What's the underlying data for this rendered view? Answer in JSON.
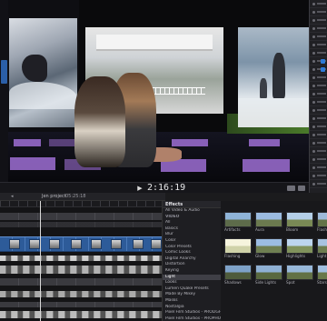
{
  "viewer": {
    "timecode": "2:16:19",
    "play_icon": "play-icon"
  },
  "timeline": {
    "project_name": "Jen project",
    "duration": "05:25:18"
  },
  "effects": {
    "title": "Effects",
    "categories": [
      {
        "label": "All Video & Audio",
        "kind": "item"
      },
      {
        "label": "VIDEO",
        "kind": "header"
      },
      {
        "label": "All",
        "kind": "item"
      },
      {
        "label": "Basics",
        "kind": "item"
      },
      {
        "label": "Blur",
        "kind": "item"
      },
      {
        "label": "Color",
        "kind": "item"
      },
      {
        "label": "Color Presets",
        "kind": "item"
      },
      {
        "label": "Comic Looks",
        "kind": "item"
      },
      {
        "label": "Digital Anarchy",
        "kind": "item"
      },
      {
        "label": "Distortion",
        "kind": "item"
      },
      {
        "label": "Keying",
        "kind": "item"
      },
      {
        "label": "Light",
        "kind": "selected"
      },
      {
        "label": "Looks",
        "kind": "item"
      },
      {
        "label": "Lumen Quake Presets",
        "kind": "item"
      },
      {
        "label": "Made By Mikey",
        "kind": "item"
      },
      {
        "label": "Masks",
        "kind": "item"
      },
      {
        "label": "Nostalgia",
        "kind": "item"
      },
      {
        "label": "Pixel Film Studios - PROLIGHTNI...",
        "kind": "item"
      },
      {
        "label": "Pixel Film Studios - PROPHOS 3X",
        "kind": "item"
      }
    ],
    "tiles": [
      {
        "label": "Artifacts",
        "top": "#8fb4d8",
        "bottom": "#5d6b4a"
      },
      {
        "label": "Aura",
        "top": "#9bbbe0",
        "bottom": "#6b7a4f"
      },
      {
        "label": "Bloom",
        "top": "#b4cfe8",
        "bottom": "#798955"
      },
      {
        "label": "Flash B",
        "top": "#9db9d9",
        "bottom": "#647347"
      },
      {
        "label": "Flashing",
        "top": "#f6f4dd",
        "bottom": "#cfd2a8"
      },
      {
        "label": "Glow",
        "top": "#9cbde3",
        "bottom": "#6f7f52"
      },
      {
        "label": "Highlights",
        "top": "#bcd5ee",
        "bottom": "#80925c"
      },
      {
        "label": "Light Rays",
        "top": "#a7c3e1",
        "bottom": "#6c7c4f"
      },
      {
        "label": "Shadows",
        "top": "#7ea2c8",
        "bottom": "#4e5b3b"
      },
      {
        "label": "Side Lights",
        "top": "#8fb0d4",
        "bottom": "#59683f"
      },
      {
        "label": "Spot",
        "top": "#98b8da",
        "bottom": "#627146"
      },
      {
        "label": "Stars",
        "top": "#a0bfe0",
        "bottom": "#687849"
      }
    ]
  }
}
